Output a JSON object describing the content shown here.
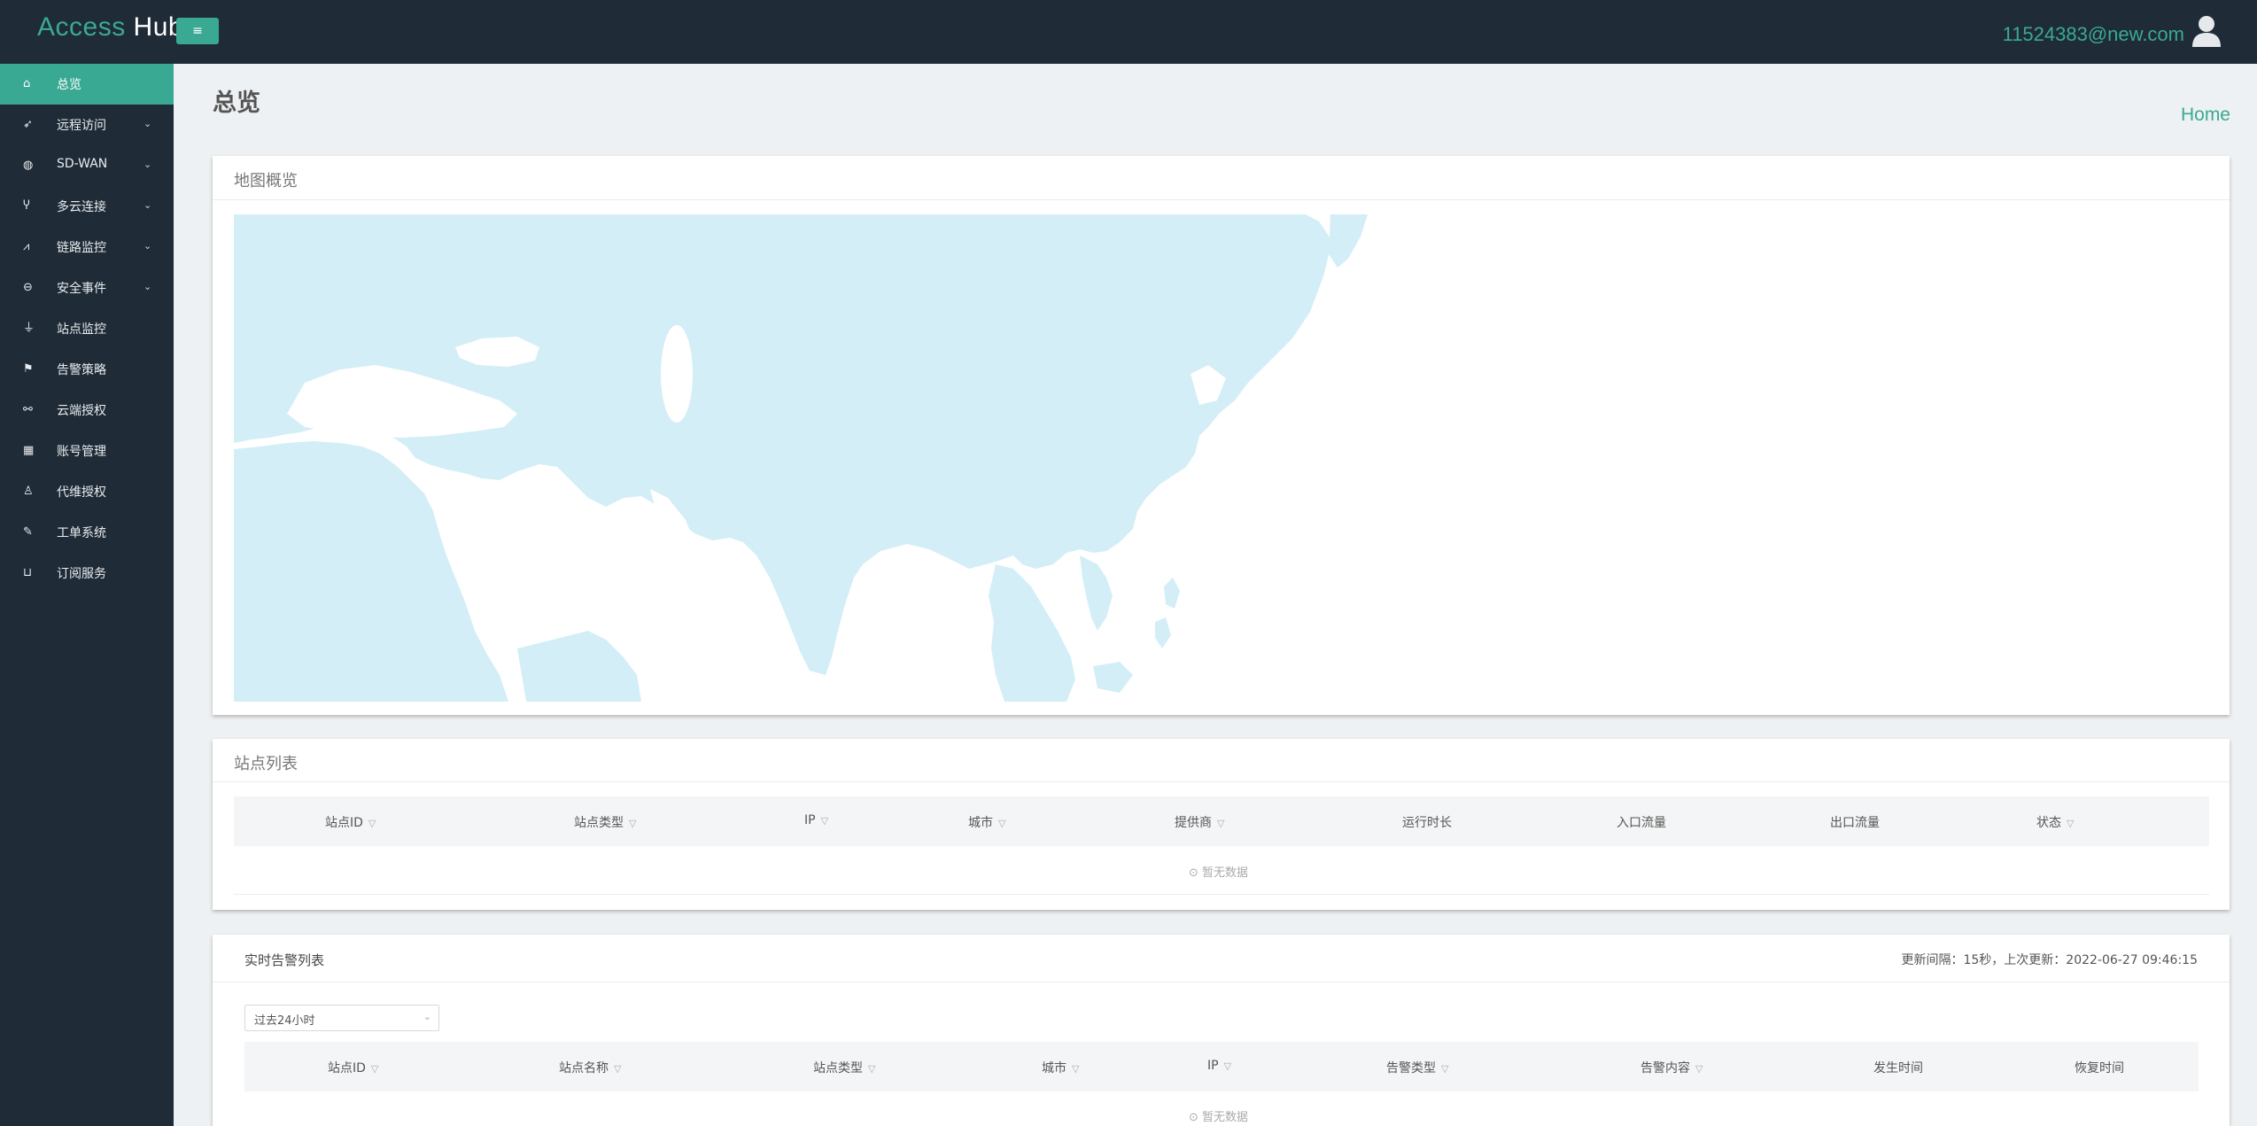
{
  "header": {
    "logo_part1": "Access",
    "logo_part2": "Hub",
    "toggle_icon": "≡",
    "user_email": "11524383@new.com"
  },
  "sidebar": {
    "items": [
      {
        "label": "总览",
        "icon": "home-icon",
        "active": true,
        "expandable": false
      },
      {
        "label": "远程访问",
        "icon": "rocket-icon",
        "active": false,
        "expandable": true
      },
      {
        "label": "SD-WAN",
        "icon": "globe-icon",
        "active": false,
        "expandable": true
      },
      {
        "label": "多云连接",
        "icon": "fork-icon",
        "active": false,
        "expandable": true
      },
      {
        "label": "链路监控",
        "icon": "line-chart-icon",
        "active": false,
        "expandable": true
      },
      {
        "label": "安全事件",
        "icon": "minus-circle-icon",
        "active": false,
        "expandable": true
      },
      {
        "label": "站点监控",
        "icon": "funnel-icon",
        "active": false,
        "expandable": false
      },
      {
        "label": "告警策略",
        "icon": "flag-icon",
        "active": false,
        "expandable": false
      },
      {
        "label": "云端授权",
        "icon": "link-icon",
        "active": false,
        "expandable": false
      },
      {
        "label": "账号管理",
        "icon": "building-icon",
        "active": false,
        "expandable": false
      },
      {
        "label": "代维授权",
        "icon": "user-icon",
        "active": false,
        "expandable": false
      },
      {
        "label": "工单系统",
        "icon": "wrench-icon",
        "active": false,
        "expandable": false
      },
      {
        "label": "订阅服务",
        "icon": "cart-icon",
        "active": false,
        "expandable": false
      }
    ]
  },
  "page": {
    "title": "总览",
    "breadcrumb": "Home"
  },
  "map_card": {
    "title": "地图概览"
  },
  "site_card": {
    "title": "站点列表",
    "columns": [
      {
        "label": "站点ID",
        "filter": true
      },
      {
        "label": "站点类型",
        "filter": true
      },
      {
        "label": "IP",
        "filter": true
      },
      {
        "label": "城市",
        "filter": true
      },
      {
        "label": "提供商",
        "filter": true
      },
      {
        "label": "运行时长",
        "filter": false
      },
      {
        "label": "入口流量",
        "filter": false
      },
      {
        "label": "出口流量",
        "filter": false
      },
      {
        "label": "状态",
        "filter": true
      }
    ],
    "empty_text": "暂无数据"
  },
  "alert_card": {
    "title": "实时告警列表",
    "meta": "更新间隔：15秒，上次更新：2022-06-27 09:46:15",
    "select_value": "过去24小时",
    "columns": [
      {
        "label": "站点ID",
        "filter": true
      },
      {
        "label": "站点名称",
        "filter": true
      },
      {
        "label": "站点类型",
        "filter": true
      },
      {
        "label": "城市",
        "filter": true
      },
      {
        "label": "IP",
        "filter": true
      },
      {
        "label": "告警类型",
        "filter": true
      },
      {
        "label": "告警内容",
        "filter": true
      },
      {
        "label": "发生时间",
        "filter": false
      },
      {
        "label": "恢复时间",
        "filter": false
      }
    ],
    "empty_text": "暂无数据"
  },
  "colors": {
    "accent": "#3aa993",
    "dark": "#1f2b37",
    "land": "#d3eef7",
    "background": "#eef1f3"
  }
}
